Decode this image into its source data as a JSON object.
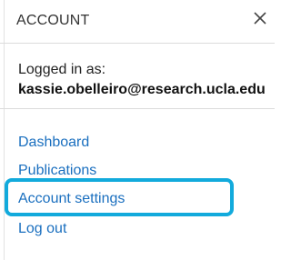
{
  "header": {
    "title": "ACCOUNT",
    "close_icon": "close-icon"
  },
  "user": {
    "logged_in_label": "Logged in as:",
    "email": "kassie.obelleiro@research.ucla.edu"
  },
  "menu": {
    "items": [
      {
        "label": "Dashboard"
      },
      {
        "label": "Publications"
      },
      {
        "label": "Account settings",
        "highlighted": true
      },
      {
        "label": "Log out"
      }
    ]
  },
  "colors": {
    "link": "#1a6fbf",
    "highlight_border": "#12aadc",
    "divider": "#dcdcdc"
  }
}
